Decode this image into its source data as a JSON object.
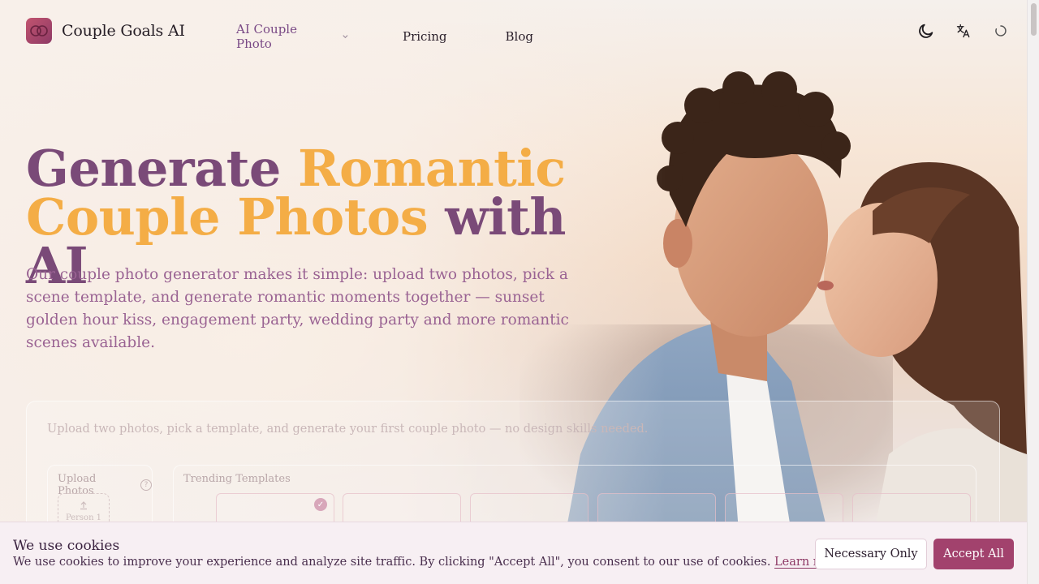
{
  "header": {
    "brand": "Couple Goals AI",
    "nav": [
      {
        "label": "AI Couple Photo",
        "active": true,
        "has_dropdown": true
      },
      {
        "label": "Pricing"
      },
      {
        "label": "Blog"
      }
    ],
    "icons": [
      "moon-icon",
      "translate-icon",
      "loading-spinner-icon"
    ]
  },
  "hero": {
    "headline_1": "Generate ",
    "headline_2": "Romantic",
    "headline_3": "Couple Photos",
    "headline_4": " with AI",
    "subhead": "Our couple photo generator makes it simple: upload two photos, pick a scene template, and generate romantic moments together — sunset golden hour kiss, engagement party, wedding party and more romantic scenes available."
  },
  "generator": {
    "intro": "Upload two photos, pick a template, and generate your first couple photo — no design skills needed.",
    "upload_title": "Upload Photos",
    "upload_slot_label": "Person 1",
    "templates_title": "Trending Templates"
  },
  "cookie": {
    "title": "We use cookies",
    "text": "We use cookies to improve your experience and analyze site traffic. By clicking \"Accept All\", you consent to our use of cookies.",
    "link": "Learn more",
    "necessary_label": "Necessary Only",
    "accept_label": "Accept All"
  },
  "colors": {
    "accent_purple": "#7a4a78",
    "accent_orange": "#f4ad46",
    "button_primary": "#a2426d"
  }
}
